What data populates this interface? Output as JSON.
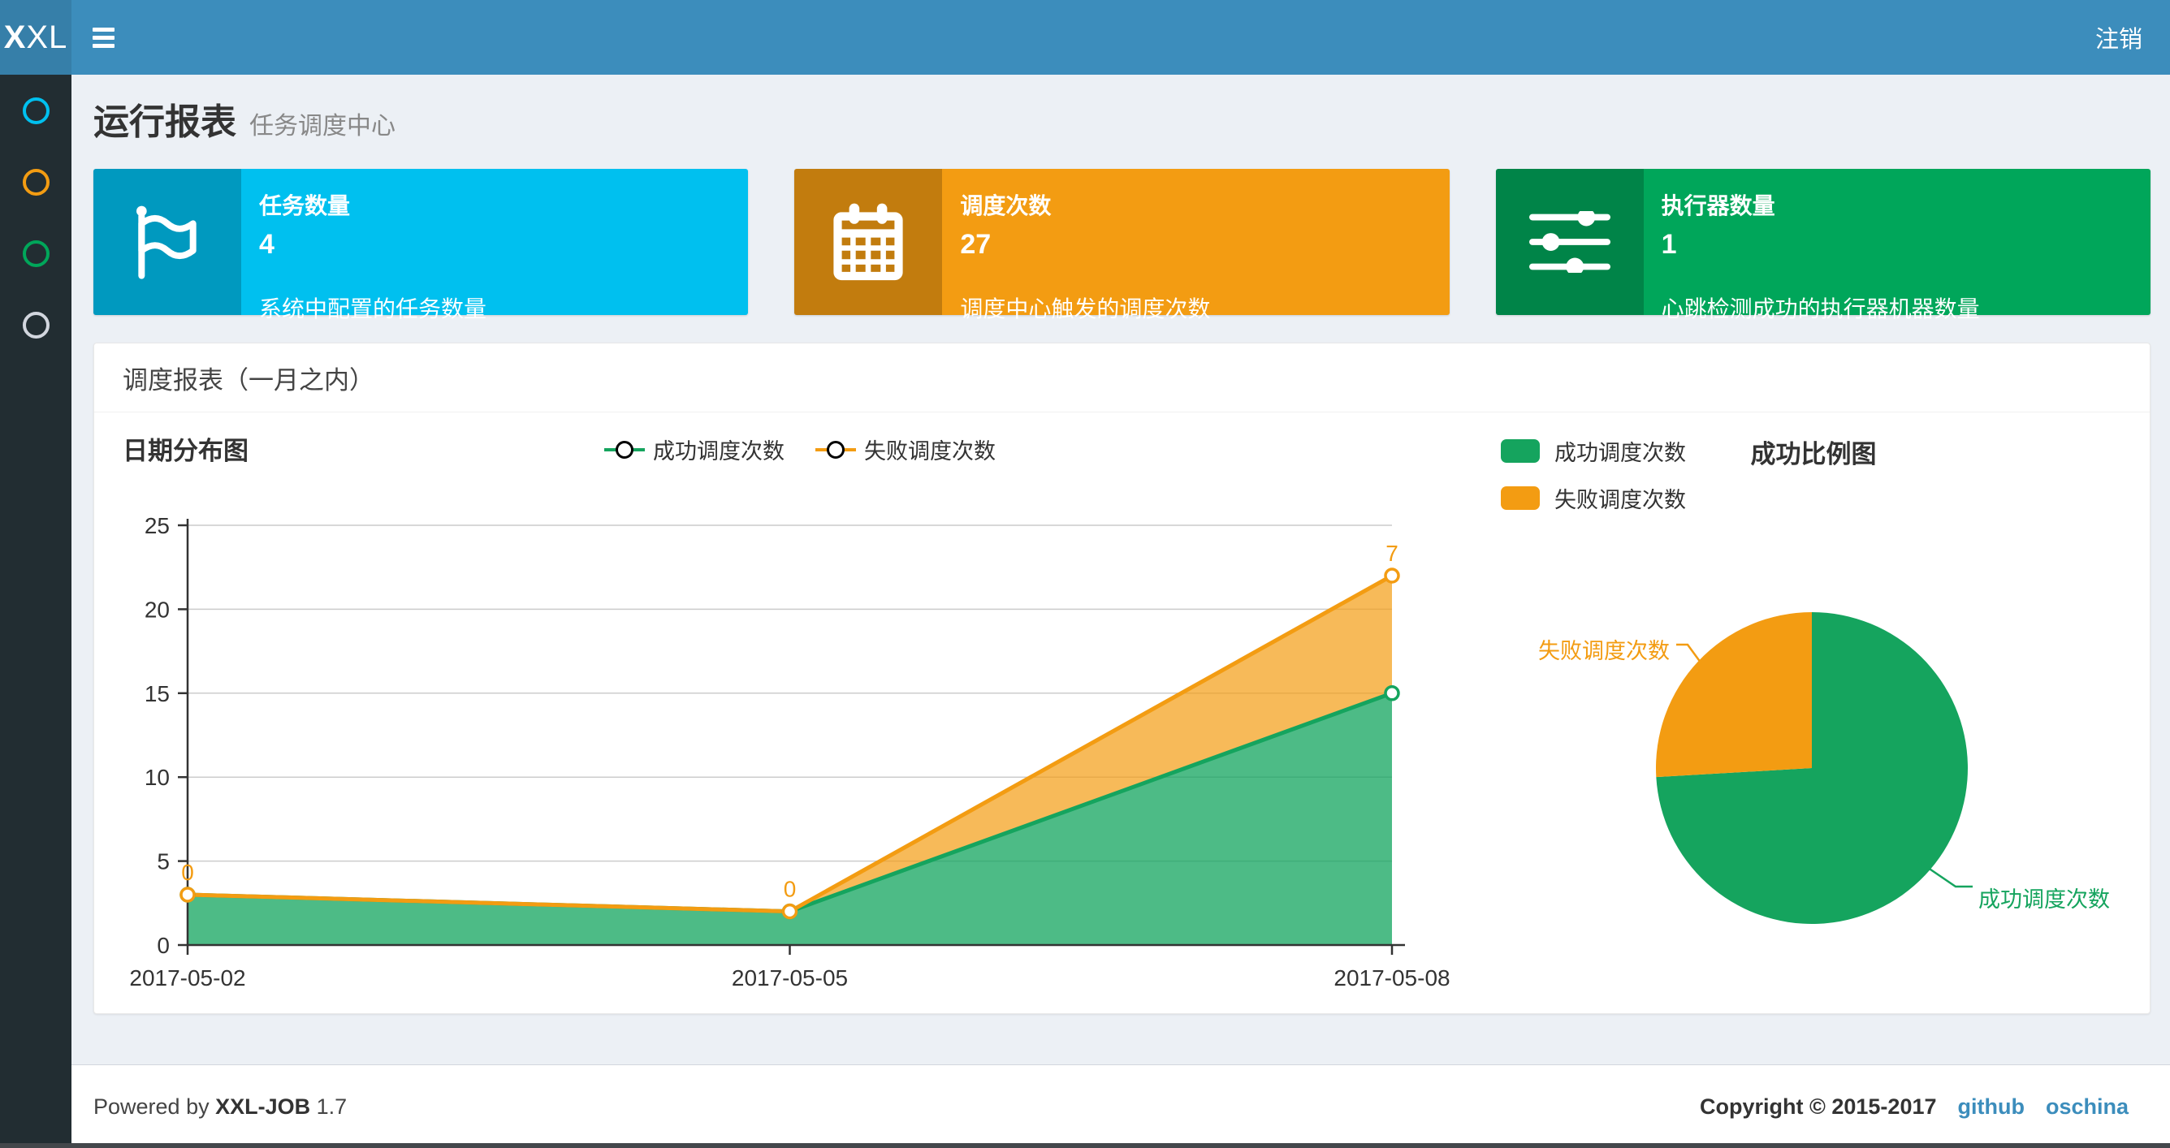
{
  "navbar": {
    "logo_bold": "X",
    "logo_light": "XL",
    "logout_label": "注销",
    "bg_color": "#3c8dbc",
    "logo_bg_color": "#367fa9"
  },
  "sidebar": {
    "bg_color": "#222d32",
    "items": [
      {
        "icon": "circle-o-icon",
        "color": "#00c0ef"
      },
      {
        "icon": "circle-o-icon",
        "color": "#f39c12"
      },
      {
        "icon": "circle-o-icon",
        "color": "#00a65a"
      },
      {
        "icon": "circle-o-icon",
        "color": "#d2d6de"
      }
    ]
  },
  "page_header": {
    "title": "运行报表",
    "subtitle": "任务调度中心"
  },
  "info_boxes": [
    {
      "label": "任务数量",
      "value": "4",
      "desc": "系统中配置的任务数量",
      "color": "#00c0ef",
      "icon": "flag-icon"
    },
    {
      "label": "调度次数",
      "value": "27",
      "desc": "调度中心触发的调度次数",
      "color": "#f39c12",
      "icon": "calendar-icon"
    },
    {
      "label": "执行器数量",
      "value": "1",
      "desc": "心跳检测成功的执行器机器数量",
      "color": "#00a65a",
      "icon": "sliders-icon"
    }
  ],
  "panel": {
    "title": "调度报表（一月之内）"
  },
  "chart_data": [
    {
      "type": "area",
      "title": "日期分布图",
      "x": [
        "2017-05-02",
        "2017-05-05",
        "2017-05-08"
      ],
      "series": [
        {
          "name": "成功调度次数",
          "values": [
            3,
            2,
            15
          ],
          "color": "#15a45e",
          "fill": "rgba(18,164,94,0.75)"
        },
        {
          "name": "失败调度次数",
          "values": [
            0,
            0,
            7
          ],
          "stacked_on_previous": true,
          "labels": [
            "0",
            "0",
            "7"
          ],
          "color": "#f39c12",
          "fill": "rgba(243,156,18,0.70)"
        }
      ],
      "ylim": [
        0,
        25
      ],
      "yticks": [
        0,
        5,
        10,
        15,
        20,
        25
      ],
      "grid": true,
      "legend_position": "top-center"
    },
    {
      "type": "pie",
      "title": "成功比例图",
      "slices": [
        {
          "name": "成功调度次数",
          "value": 20,
          "color": "#15a45e"
        },
        {
          "name": "失败调度次数",
          "value": 7,
          "color": "#f39c12"
        }
      ],
      "legend_position": "top-left"
    }
  ],
  "footer": {
    "powered_prefix": "Powered by",
    "brand": "XXL-JOB",
    "version": "1.7",
    "copyright": "Copyright © 2015-2017",
    "link_github": "github",
    "link_oschina": "oschina"
  }
}
